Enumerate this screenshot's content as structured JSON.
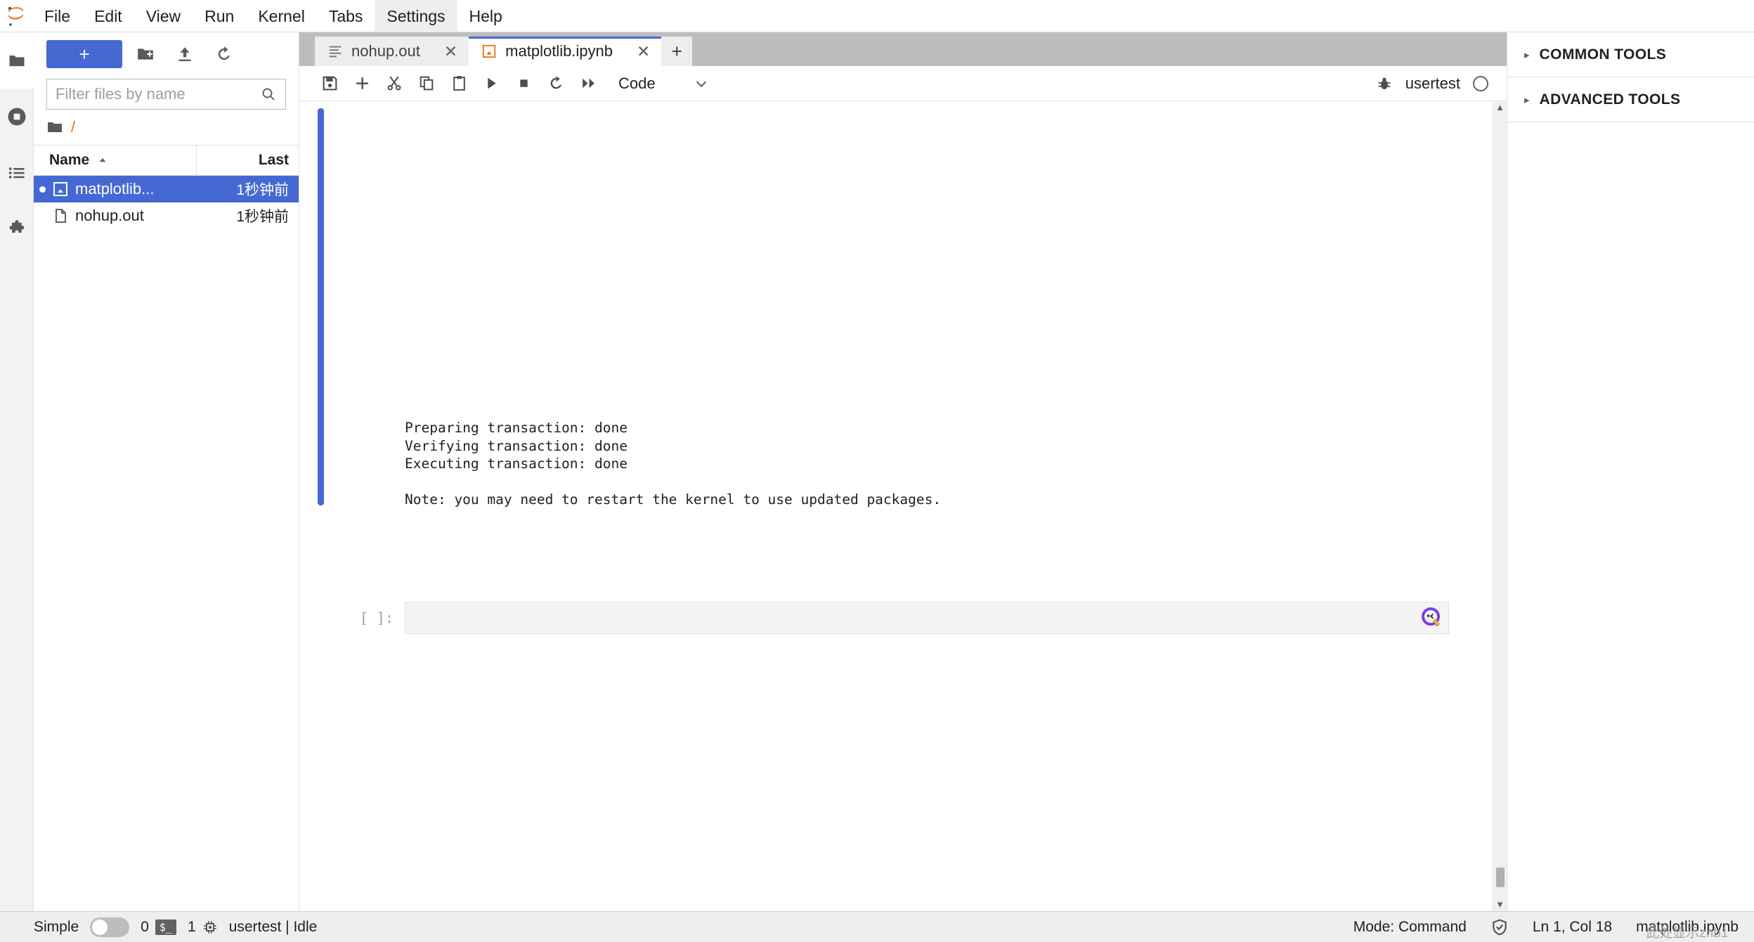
{
  "app": {
    "logo_icon": "jupyter-logo-icon",
    "menu": [
      {
        "label": "File",
        "active": false
      },
      {
        "label": "Edit",
        "active": false
      },
      {
        "label": "View",
        "active": false
      },
      {
        "label": "Run",
        "active": false
      },
      {
        "label": "Kernel",
        "active": false
      },
      {
        "label": "Tabs",
        "active": false
      },
      {
        "label": "Settings",
        "active": true
      },
      {
        "label": "Help",
        "active": false
      }
    ]
  },
  "activitybar": {
    "items": [
      {
        "name": "file-browser",
        "icon": "folder-icon",
        "active": true
      },
      {
        "name": "running-sessions",
        "icon": "stop-circle-icon",
        "active": false
      },
      {
        "name": "commands",
        "icon": "list-icon",
        "active": false
      },
      {
        "name": "extensions",
        "icon": "puzzle-icon",
        "active": false
      }
    ]
  },
  "filebrowser": {
    "new_launcher_label": "+",
    "toolbar_icons": [
      "new-folder-icon",
      "upload-icon",
      "refresh-icon"
    ],
    "filter": {
      "placeholder": "Filter files by name",
      "value": "",
      "icon": "search-icon"
    },
    "breadcrumb": {
      "root_icon": "folder-icon",
      "path": "/"
    },
    "columns": {
      "name": "Name",
      "last_modified": "Last Modified",
      "sort_icon": "sort-ascending-icon"
    },
    "files": [
      {
        "name": "matplotlib...",
        "modified": "1秒钟前",
        "icon": "notebook-icon",
        "selected": true,
        "dirty": true
      },
      {
        "name": "nohup.out",
        "modified": "1秒钟前",
        "icon": "file-icon",
        "selected": false,
        "dirty": false
      }
    ]
  },
  "dock": {
    "tabs": [
      {
        "label": "nohup.out",
        "icon": "text-file-icon",
        "active": false,
        "close_icon": "close-icon"
      },
      {
        "label": "matplotlib.ipynb",
        "icon": "notebook-icon",
        "active": true,
        "close_icon": "close-icon"
      }
    ],
    "add_tab_label": "+"
  },
  "notebook_toolbar": {
    "buttons": [
      {
        "name": "save-button",
        "icon": "save-icon"
      },
      {
        "name": "insert-cell-button",
        "icon": "plus-icon"
      },
      {
        "name": "cut-button",
        "icon": "scissors-icon"
      },
      {
        "name": "copy-button",
        "icon": "copy-icon"
      },
      {
        "name": "paste-button",
        "icon": "clipboard-icon"
      },
      {
        "name": "run-button",
        "icon": "play-icon"
      },
      {
        "name": "stop-button",
        "icon": "stop-icon"
      },
      {
        "name": "restart-button",
        "icon": "restart-icon"
      },
      {
        "name": "restart-run-all-button",
        "icon": "fast-forward-icon"
      }
    ],
    "cell_type": "Code",
    "cell_type_caret": "chevron-down-icon",
    "debugger_icon": "bug-icon",
    "kernel_name": "usertest",
    "kernel_status_icon": "idle-circle-icon"
  },
  "notebook": {
    "output_text": "Preparing transaction: done\nVerifying transaction: done\nExecuting transaction: done\n\nNote: you may need to restart the kernel to use updated packages.",
    "input_cell": {
      "prompt": "[ ]:",
      "value": "",
      "ai_icon": "ai-assistant-icon"
    }
  },
  "rightpanel": {
    "sections": [
      {
        "title": "COMMON TOOLS",
        "caret": "caret-right-icon",
        "expanded": false
      },
      {
        "title": "ADVANCED TOOLS",
        "caret": "caret-right-icon",
        "expanded": false
      }
    ]
  },
  "statusbar": {
    "simple_label": "Simple",
    "simple_on": false,
    "terminals_count": "0",
    "terminal_icon_label": "$_",
    "kernels_count": "1",
    "kernel_icon": "cpu-icon",
    "kernel_status": "usertest | Idle",
    "mode": "Mode: Command",
    "trust_icon": "shield-check-icon",
    "cursor_position": "Ln 1, Col 18",
    "filename": "matplotlib.ipynb",
    "watermark": "此处显示zhb1"
  },
  "colors": {
    "accent": "#4668d3",
    "tabbar_bg": "#bdbdbd",
    "statusbar_bg": "#eeeeee",
    "brand_orange": "#e8701a"
  }
}
